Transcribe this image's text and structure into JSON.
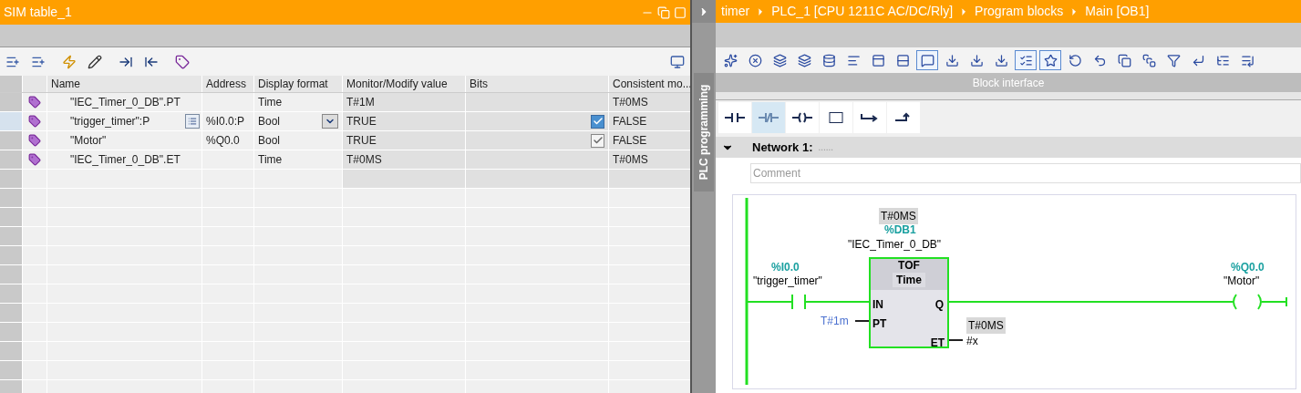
{
  "sim_table": {
    "title": "SIM table_1",
    "columns": [
      "Name",
      "Address",
      "Display format",
      "Monitor/Modify value",
      "Bits",
      "Consistent mo..."
    ],
    "rows": [
      {
        "name": "\"IEC_Timer_0_DB\".PT",
        "address": "",
        "display_format": "Time",
        "monitor_value": "T#1M",
        "consistent": "T#0MS",
        "selected": false
      },
      {
        "name": "\"trigger_timer\":P",
        "address": "%I0.0:P",
        "display_format": "Bool",
        "monitor_value": "TRUE",
        "bits": {
          "checked": true
        },
        "consistent": "FALSE",
        "selected": true
      },
      {
        "name": "\"Motor\"",
        "address": "%Q0.0",
        "display_format": "Bool",
        "monitor_value": "TRUE",
        "bits": {
          "checked": true
        },
        "consistent": "FALSE",
        "selected": false
      },
      {
        "name": "\"IEC_Timer_0_DB\".ET",
        "address": "",
        "display_format": "Time",
        "monitor_value": "T#0MS",
        "consistent": "T#0MS",
        "selected": false
      }
    ]
  },
  "side_tab": {
    "label": "PLC programming"
  },
  "editor": {
    "breadcrumb": [
      "timer",
      "PLC_1 [CPU 1211C AC/DC/Rly]",
      "Program blocks",
      "Main [OB1]"
    ],
    "toolbar": [
      {
        "selected": false
      },
      {
        "selected": false
      },
      {
        "selected": false
      },
      {
        "selected": false
      },
      {
        "selected": false
      },
      {
        "selected": false
      },
      {
        "selected": false
      },
      {
        "selected": false
      },
      {
        "selected": true
      },
      {
        "selected": false
      },
      {
        "selected": false
      },
      {
        "selected": false
      },
      {
        "selected": true
      },
      {
        "selected": true
      },
      {
        "selected": false
      },
      {
        "selected": false
      },
      {
        "selected": false
      },
      {
        "selected": false
      },
      {
        "selected": false
      },
      {
        "selected": false
      },
      {
        "selected": false
      },
      {
        "selected": false
      }
    ],
    "block_interface": "Block interface",
    "instructions": [
      {
        "selected": false
      },
      {
        "selected": true
      },
      {
        "selected": false
      },
      {
        "selected": false
      },
      {
        "selected": false
      },
      {
        "selected": false
      }
    ],
    "network": {
      "title": "Network 1:",
      "title_placeholder": "......",
      "comment_placeholder": "Comment",
      "expanded": true,
      "ladder": {
        "powered": true,
        "contact": {
          "address": "%I0.0",
          "tag": "\"trigger_timer\""
        },
        "block": {
          "instance_value": "T#0MS",
          "instance_db": "%DB1",
          "instance_name": "\"IEC_Timer_0_DB\"",
          "type": "TOF",
          "subtype": "Time",
          "pins": [
            "IN",
            "PT",
            "Q",
            "ET"
          ],
          "pt_value": "T#1m",
          "et_value": "T#0MS",
          "et_output": "#x"
        },
        "coil": {
          "address": "%Q0.0",
          "tag": "\"Motor\""
        }
      }
    }
  }
}
